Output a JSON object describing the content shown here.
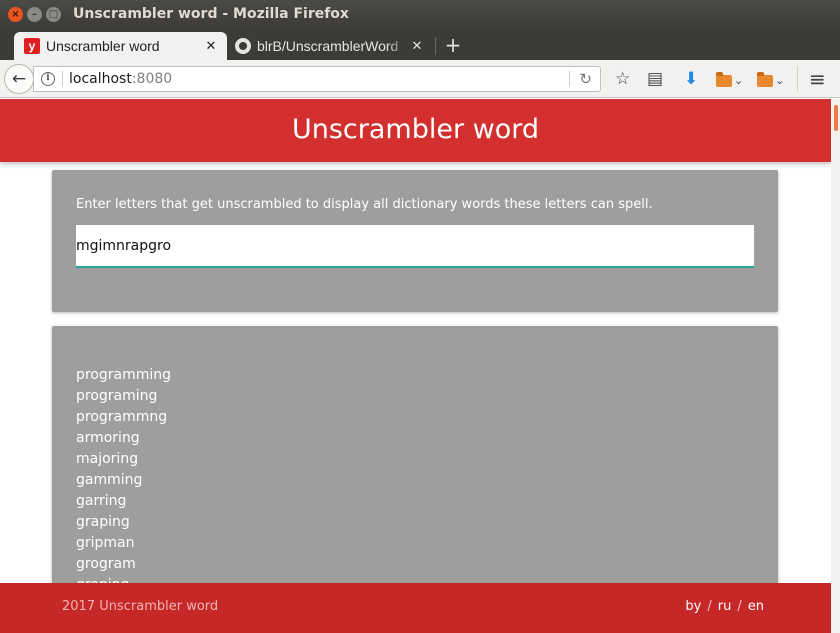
{
  "window": {
    "title": "Unscrambler word - Mozilla Firefox",
    "close_glyph": "×",
    "minimize_glyph": "–",
    "maximize_glyph": "□"
  },
  "tabs": [
    {
      "label": "Unscrambler word",
      "favicon": "y",
      "active": true,
      "close": "✕"
    },
    {
      "label": "blrB/UnscramblerWord",
      "favicon": "github-icon",
      "active": false,
      "close": "✕"
    }
  ],
  "new_tab": "+",
  "navbar": {
    "back_glyph": "←",
    "url_host": "localhost",
    "url_port": ":8080",
    "reload_glyph": "↻",
    "star_glyph": "☆",
    "reader_glyph": "▤",
    "download_glyph": "⬇",
    "chevron_glyph": "⌄",
    "menu_glyph": "≡"
  },
  "app": {
    "title": "Unscrambler word",
    "instructions": "Enter letters that get unscrambled to display all dictionary words these letters can spell.",
    "input_value": "mgimnrapgro",
    "results": [
      "programming",
      "programing",
      "programmng",
      "armoring",
      "majoring",
      "gamming",
      "garring",
      "graping",
      "gripman",
      "grogram",
      "groping"
    ]
  },
  "footer": {
    "copyright": "2017 Unscrambler word",
    "languages": [
      "by",
      "ru",
      "en"
    ],
    "separator": "/"
  },
  "colors": {
    "header": "#d32f2f",
    "footer": "#c62828",
    "card": "#9e9e9e",
    "input_underline": "#26a69a",
    "download_icon": "#1e88e5"
  }
}
